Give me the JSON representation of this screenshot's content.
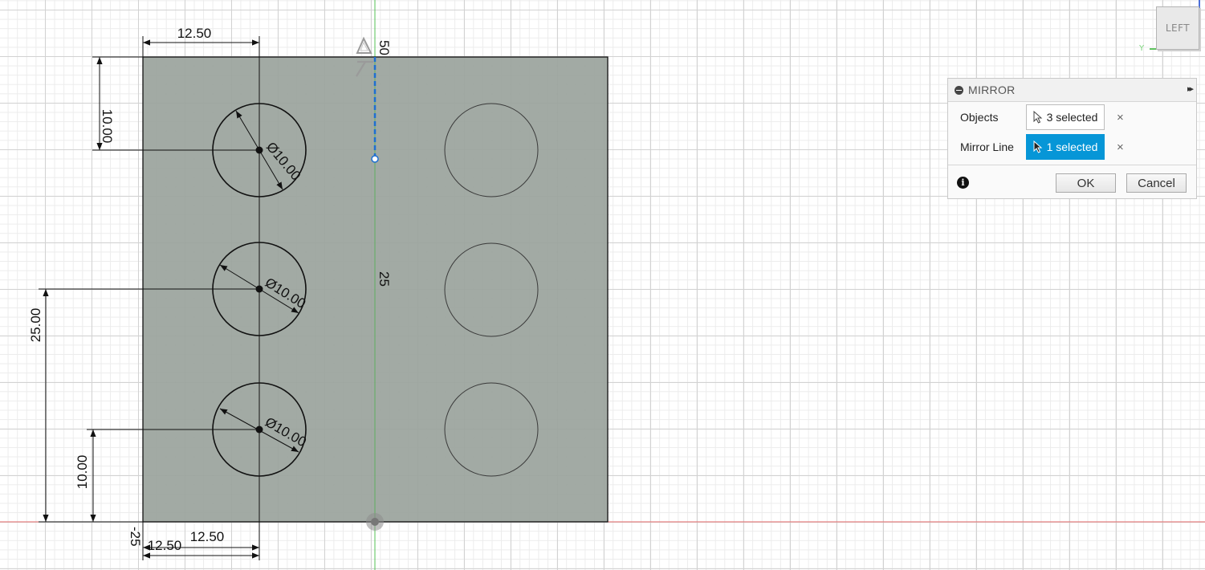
{
  "sketch": {
    "dimensions": {
      "top_width": "12.50",
      "top_offset": "10.00",
      "hole_dia_1": "Ø10.00",
      "hole_dia_2": "Ø10.00",
      "hole_dia_3": "Ø10.00",
      "left_height": "25.00",
      "bottom_offset": "10.00",
      "bottom_width_a": "12.50",
      "bottom_width_b": "12.50",
      "axis_top": "50",
      "axis_mid": "25",
      "axis_left": "-25"
    },
    "colors": {
      "profile_fill": "#9aa39c",
      "mirror_line": "#1e6fd1",
      "x_axis": "#e56b6b",
      "y_axis": "#55c255"
    }
  },
  "viewcube": {
    "face": "LEFT",
    "axis_label": "Y"
  },
  "mirror_panel": {
    "title": "MIRROR",
    "objects_label": "Objects",
    "objects_value": "3 selected",
    "mirror_line_label": "Mirror Line",
    "mirror_line_value": "1 selected",
    "clear_glyph": "×",
    "ok_label": "OK",
    "cancel_label": "Cancel",
    "info_glyph": "i",
    "expand_glyph": "▸▸"
  }
}
